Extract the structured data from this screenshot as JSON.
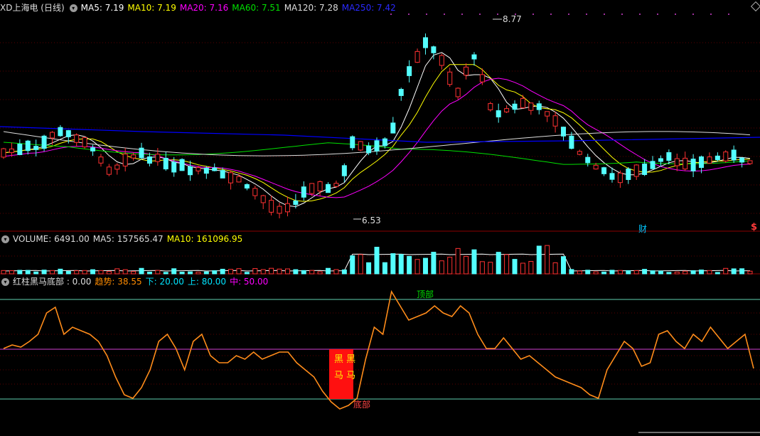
{
  "main": {
    "title": "XD上海电 (日线)",
    "ma": [
      {
        "label": "MA5: 7.19",
        "color": "#ffffff"
      },
      {
        "label": "MA10: 7.19",
        "color": "#ffff00"
      },
      {
        "label": "MA20: 7.16",
        "color": "#ff00ff"
      },
      {
        "label": "MA60: 7.51",
        "color": "#00e000"
      },
      {
        "label": "MA120: 7.28",
        "color": "#dddddd"
      },
      {
        "label": "MA250: 7.42",
        "color": "#0000ff"
      }
    ],
    "high_label": "8.77",
    "low_label": "6.53",
    "finance_badge": "财",
    "dollar_badge": "$"
  },
  "volume": {
    "items": [
      {
        "label": "VOLUME: 6491.00",
        "color": "#dddddd"
      },
      {
        "label": "MA5: 157565.47",
        "color": "#dddddd"
      },
      {
        "label": "MA10: 161096.95",
        "color": "#ffff00"
      }
    ]
  },
  "indicator": {
    "items": [
      {
        "label": "红柱黑马底部 : 0.00",
        "color": "#dddddd"
      },
      {
        "label": "趋势: 38.55",
        "color": "#ff8c00"
      },
      {
        "label": "下: 20.00",
        "color": "#00e5ff"
      },
      {
        "label": "上: 80.00",
        "color": "#00e5ff"
      },
      {
        "label": "中: 50.00",
        "color": "#ff00ff"
      }
    ],
    "top_label": "顶部",
    "bottom_label": "底部",
    "hm_text_1": "黑 黑",
    "hm_text_2": "马 马"
  },
  "colors": {
    "up": "#ff3232",
    "down": "#54ffff",
    "trend": "#ff8c1a",
    "level": "#5fd0b0",
    "mid": "#d040d0",
    "grid": "#5a0000"
  }
}
